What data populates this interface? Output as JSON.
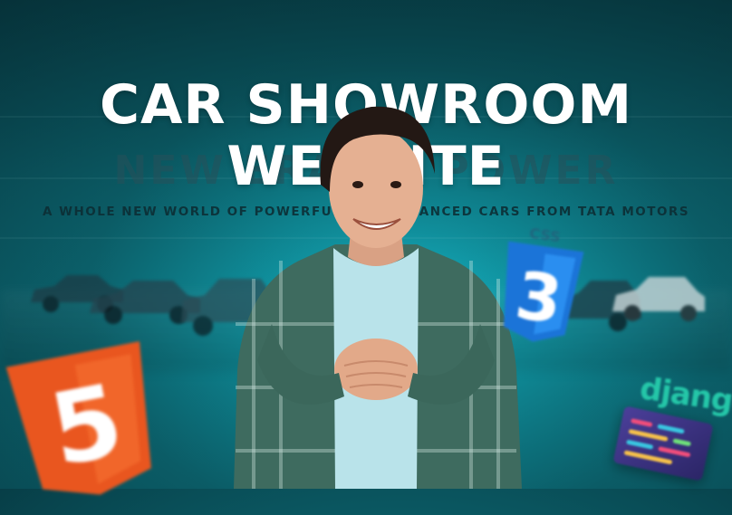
{
  "banner": {
    "title_line1": "CAR SHOWROOM",
    "title_line2": "WEBSITE",
    "ghost_text": "NEW ERA OF POWER",
    "tagline": "A WHOLE NEW WORLD OF POWERFUL AND ADVANCED CARS FROM TATA MOTORS"
  },
  "badges": {
    "html5_label": "5",
    "css3_label": "CSS",
    "css3_number": "3",
    "django_label": "django"
  },
  "colors": {
    "background": "#0f8f9c",
    "title": "#ffffff",
    "html5": "#e9561f",
    "css3": "#1b74d8",
    "django": "#24c6a8",
    "shirt": "#3e6b5f"
  },
  "icons": [
    "html5-logo-icon",
    "css3-logo-icon",
    "django-logo-icon",
    "code-panel-icon"
  ]
}
